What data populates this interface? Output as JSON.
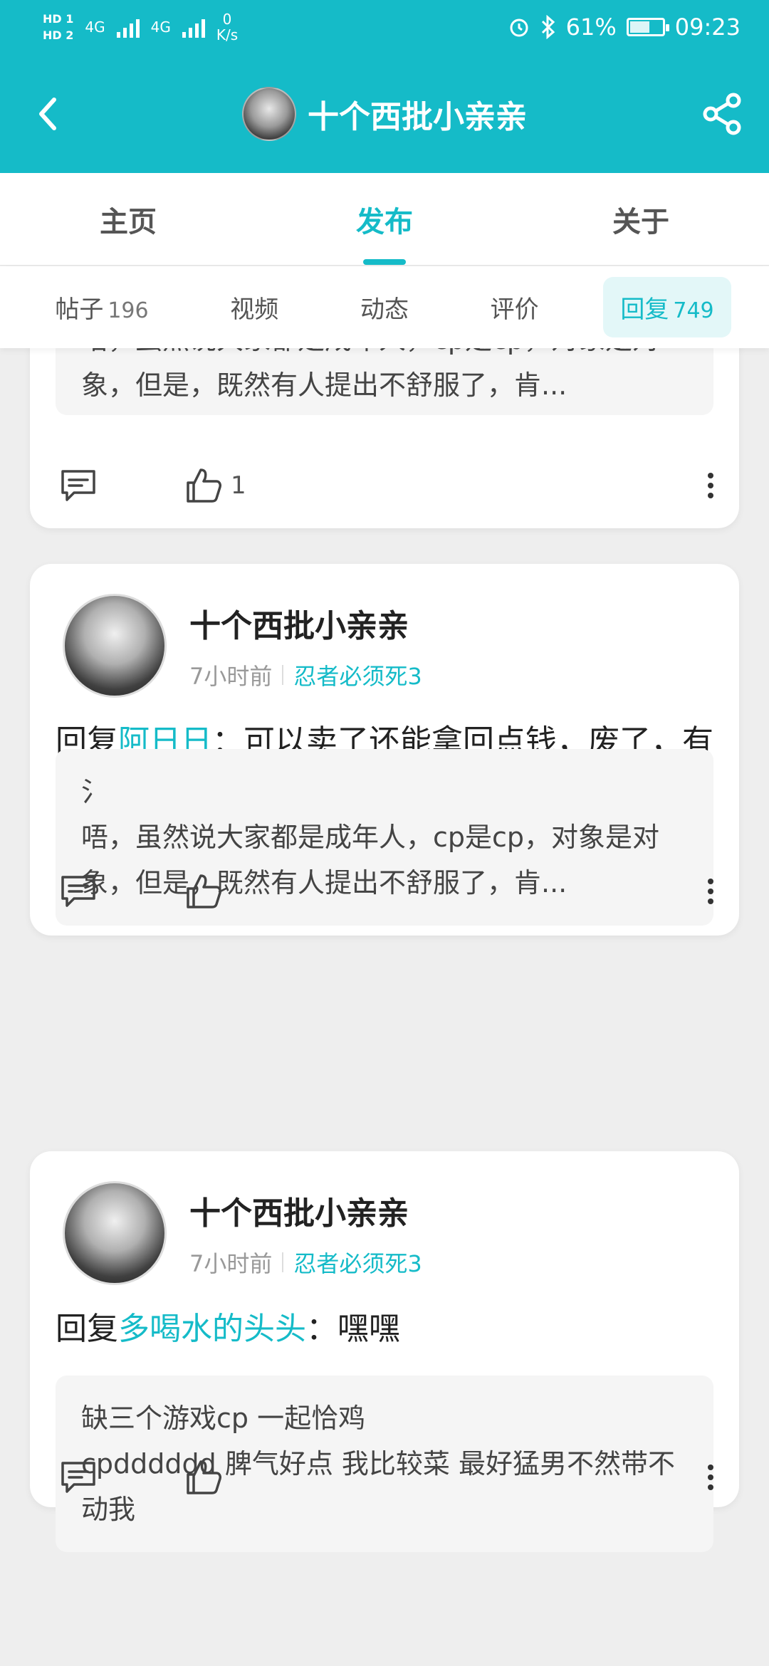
{
  "status_bar": {
    "hd1": "HD 1",
    "hd2": "HD 2",
    "net_type_1": "4G",
    "net_type_2": "4G",
    "net_speed_value": "0",
    "net_speed_unit": "K/s",
    "battery_percent": "61%",
    "time": "09:23",
    "battery_level": 0.61
  },
  "header": {
    "title": "十个西批小亲亲",
    "back_icon": "chevron-left-icon",
    "share_icon": "share-icon"
  },
  "tabs": [
    {
      "label": "主页",
      "active": false
    },
    {
      "label": "发布",
      "active": true
    },
    {
      "label": "关于",
      "active": false
    }
  ],
  "subtabs": [
    {
      "label": "帖子",
      "count": "196",
      "active": false
    },
    {
      "label": "视频",
      "count": "",
      "active": false
    },
    {
      "label": "动态",
      "count": "",
      "active": false
    },
    {
      "label": "评价",
      "count": "",
      "active": false
    },
    {
      "label": "回复",
      "count": "749",
      "active": true
    }
  ],
  "cards": [
    {
      "quote_body": "唔，虽然说大家都是成年人，cp是cp，对象是对象，但是，既然有人提出不舒服了，肯...",
      "like_count": "1"
    },
    {
      "username": "十个西批小亲亲",
      "time": "7小时前",
      "game": "忍者必须死3",
      "reply_prefix": "回复",
      "mention": "阿日日",
      "reply_body": "：可以卖了还能拿回点钱，废了，有点亏o(｀・ω・´)o",
      "quote_title": "氵",
      "quote_body": "唔，虽然说大家都是成年人，cp是cp，对象是对象，但是，既然有人提出不舒服了，肯...",
      "like_count": ""
    },
    {
      "username": "十个西批小亲亲",
      "time": "7小时前",
      "game": "忍者必须死3",
      "reply_prefix": "回复",
      "mention": "多喝水的头头",
      "reply_body": "：嘿嘿",
      "quote_title": "缺三个游戏cp 一起恰鸡",
      "quote_body": "cpdddddd 脾气好点 我比较菜 最好猛男不然带不动我",
      "like_count": ""
    }
  ],
  "icons": {
    "comment": "comment-icon",
    "like": "thumbs-up-icon",
    "more": "more-vertical-icon"
  },
  "colors": {
    "accent": "#15bbc8",
    "background": "#eeeeee"
  }
}
